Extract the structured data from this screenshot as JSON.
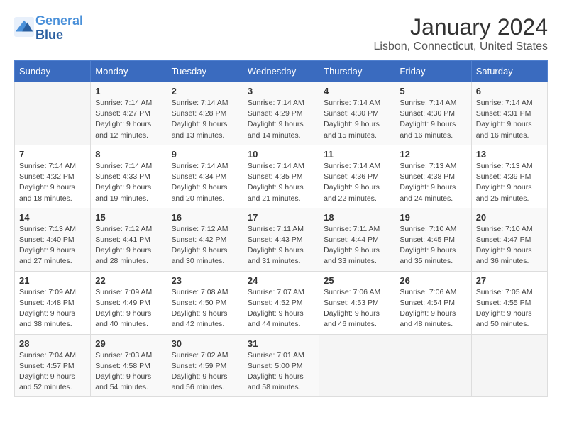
{
  "header": {
    "logo_line1": "General",
    "logo_line2": "Blue",
    "title": "January 2024",
    "subtitle": "Lisbon, Connecticut, United States"
  },
  "calendar": {
    "days_of_week": [
      "Sunday",
      "Monday",
      "Tuesday",
      "Wednesday",
      "Thursday",
      "Friday",
      "Saturday"
    ],
    "weeks": [
      [
        {
          "day": null,
          "sunrise": null,
          "sunset": null,
          "daylight": null
        },
        {
          "day": "1",
          "sunrise": "7:14 AM",
          "sunset": "4:27 PM",
          "daylight": "9 hours and 12 minutes."
        },
        {
          "day": "2",
          "sunrise": "7:14 AM",
          "sunset": "4:28 PM",
          "daylight": "9 hours and 13 minutes."
        },
        {
          "day": "3",
          "sunrise": "7:14 AM",
          "sunset": "4:29 PM",
          "daylight": "9 hours and 14 minutes."
        },
        {
          "day": "4",
          "sunrise": "7:14 AM",
          "sunset": "4:30 PM",
          "daylight": "9 hours and 15 minutes."
        },
        {
          "day": "5",
          "sunrise": "7:14 AM",
          "sunset": "4:30 PM",
          "daylight": "9 hours and 16 minutes."
        },
        {
          "day": "6",
          "sunrise": "7:14 AM",
          "sunset": "4:31 PM",
          "daylight": "9 hours and 16 minutes."
        }
      ],
      [
        {
          "day": "7",
          "sunrise": "7:14 AM",
          "sunset": "4:32 PM",
          "daylight": "9 hours and 18 minutes."
        },
        {
          "day": "8",
          "sunrise": "7:14 AM",
          "sunset": "4:33 PM",
          "daylight": "9 hours and 19 minutes."
        },
        {
          "day": "9",
          "sunrise": "7:14 AM",
          "sunset": "4:34 PM",
          "daylight": "9 hours and 20 minutes."
        },
        {
          "day": "10",
          "sunrise": "7:14 AM",
          "sunset": "4:35 PM",
          "daylight": "9 hours and 21 minutes."
        },
        {
          "day": "11",
          "sunrise": "7:14 AM",
          "sunset": "4:36 PM",
          "daylight": "9 hours and 22 minutes."
        },
        {
          "day": "12",
          "sunrise": "7:13 AM",
          "sunset": "4:38 PM",
          "daylight": "9 hours and 24 minutes."
        },
        {
          "day": "13",
          "sunrise": "7:13 AM",
          "sunset": "4:39 PM",
          "daylight": "9 hours and 25 minutes."
        }
      ],
      [
        {
          "day": "14",
          "sunrise": "7:13 AM",
          "sunset": "4:40 PM",
          "daylight": "9 hours and 27 minutes."
        },
        {
          "day": "15",
          "sunrise": "7:12 AM",
          "sunset": "4:41 PM",
          "daylight": "9 hours and 28 minutes."
        },
        {
          "day": "16",
          "sunrise": "7:12 AM",
          "sunset": "4:42 PM",
          "daylight": "9 hours and 30 minutes."
        },
        {
          "day": "17",
          "sunrise": "7:11 AM",
          "sunset": "4:43 PM",
          "daylight": "9 hours and 31 minutes."
        },
        {
          "day": "18",
          "sunrise": "7:11 AM",
          "sunset": "4:44 PM",
          "daylight": "9 hours and 33 minutes."
        },
        {
          "day": "19",
          "sunrise": "7:10 AM",
          "sunset": "4:45 PM",
          "daylight": "9 hours and 35 minutes."
        },
        {
          "day": "20",
          "sunrise": "7:10 AM",
          "sunset": "4:47 PM",
          "daylight": "9 hours and 36 minutes."
        }
      ],
      [
        {
          "day": "21",
          "sunrise": "7:09 AM",
          "sunset": "4:48 PM",
          "daylight": "9 hours and 38 minutes."
        },
        {
          "day": "22",
          "sunrise": "7:09 AM",
          "sunset": "4:49 PM",
          "daylight": "9 hours and 40 minutes."
        },
        {
          "day": "23",
          "sunrise": "7:08 AM",
          "sunset": "4:50 PM",
          "daylight": "9 hours and 42 minutes."
        },
        {
          "day": "24",
          "sunrise": "7:07 AM",
          "sunset": "4:52 PM",
          "daylight": "9 hours and 44 minutes."
        },
        {
          "day": "25",
          "sunrise": "7:06 AM",
          "sunset": "4:53 PM",
          "daylight": "9 hours and 46 minutes."
        },
        {
          "day": "26",
          "sunrise": "7:06 AM",
          "sunset": "4:54 PM",
          "daylight": "9 hours and 48 minutes."
        },
        {
          "day": "27",
          "sunrise": "7:05 AM",
          "sunset": "4:55 PM",
          "daylight": "9 hours and 50 minutes."
        }
      ],
      [
        {
          "day": "28",
          "sunrise": "7:04 AM",
          "sunset": "4:57 PM",
          "daylight": "9 hours and 52 minutes."
        },
        {
          "day": "29",
          "sunrise": "7:03 AM",
          "sunset": "4:58 PM",
          "daylight": "9 hours and 54 minutes."
        },
        {
          "day": "30",
          "sunrise": "7:02 AM",
          "sunset": "4:59 PM",
          "daylight": "9 hours and 56 minutes."
        },
        {
          "day": "31",
          "sunrise": "7:01 AM",
          "sunset": "5:00 PM",
          "daylight": "9 hours and 58 minutes."
        },
        {
          "day": null,
          "sunrise": null,
          "sunset": null,
          "daylight": null
        },
        {
          "day": null,
          "sunrise": null,
          "sunset": null,
          "daylight": null
        },
        {
          "day": null,
          "sunrise": null,
          "sunset": null,
          "daylight": null
        }
      ]
    ],
    "labels": {
      "sunrise": "Sunrise:",
      "sunset": "Sunset:",
      "daylight": "Daylight:"
    }
  }
}
